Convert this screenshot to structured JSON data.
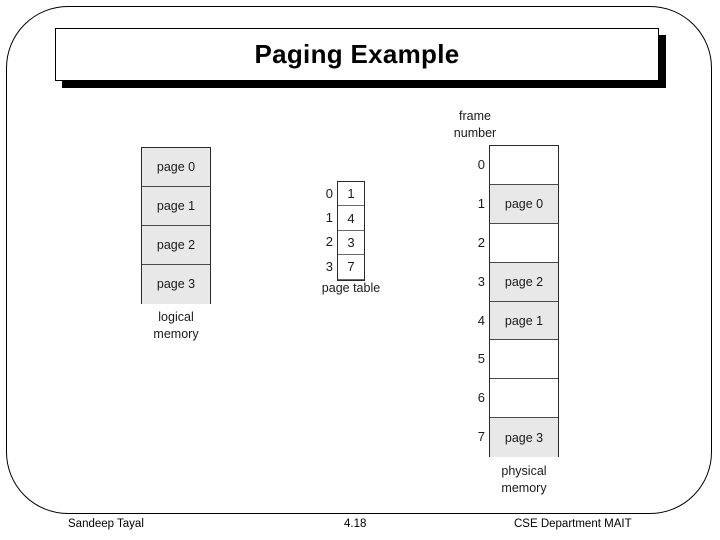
{
  "slide": {
    "title": "Paging Example",
    "accent_color": "#000000",
    "cell_fill_color": "#e8e8e8",
    "background_color": "#ffffff"
  },
  "logical_memory": {
    "caption_line1": "logical",
    "caption_line2": "memory",
    "cells": [
      {
        "label": "page 0"
      },
      {
        "label": "page 1"
      },
      {
        "label": "page 2"
      },
      {
        "label": "page 3"
      }
    ]
  },
  "page_table": {
    "caption": "page table",
    "indices": [
      "0",
      "1",
      "2",
      "3"
    ],
    "entries": [
      "1",
      "4",
      "3",
      "7"
    ]
  },
  "physical_memory": {
    "header_line1": "frame",
    "header_line2": "number",
    "caption_line1": "physical",
    "caption_line2": "memory",
    "indices": [
      "0",
      "1",
      "2",
      "3",
      "4",
      "5",
      "6",
      "7"
    ],
    "frames": [
      {
        "label": ""
      },
      {
        "label": "page 0"
      },
      {
        "label": ""
      },
      {
        "label": "page 2"
      },
      {
        "label": "page 1"
      },
      {
        "label": ""
      },
      {
        "label": ""
      },
      {
        "label": "page 3"
      }
    ]
  },
  "footer": {
    "author": "Sandeep Tayal",
    "page_number": "4.18",
    "department": "CSE Department MAIT"
  }
}
